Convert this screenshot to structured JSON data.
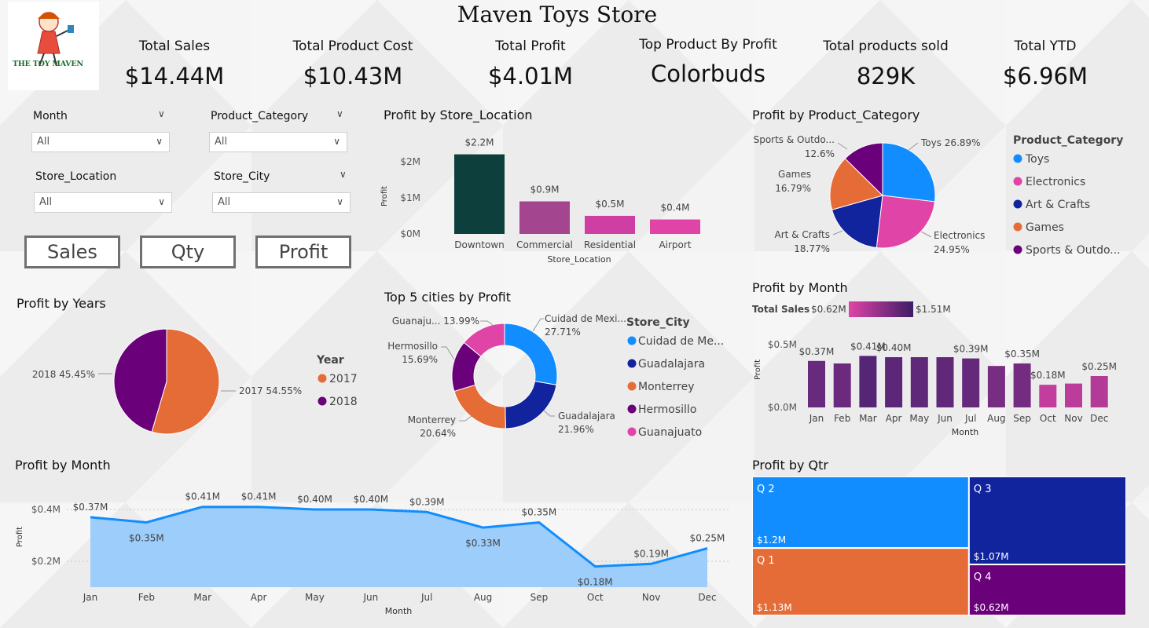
{
  "header": {
    "title": "Maven Toys Store",
    "logo_text": "THE TOY MAVEN"
  },
  "kpis": [
    {
      "label": "Total Sales",
      "value": "$14.44M"
    },
    {
      "label": "Total Product Cost",
      "value": "$10.43M"
    },
    {
      "label": "Total Profit",
      "value": "$4.01M"
    },
    {
      "label": "Top Product By Profit",
      "value": "Colorbuds"
    },
    {
      "label": "Total products sold",
      "value": "829K"
    },
    {
      "label": "Total YTD",
      "value": "$6.96M"
    }
  ],
  "slicers": [
    {
      "label": "Month",
      "value": "All"
    },
    {
      "label": "Product_Category",
      "value": "All"
    },
    {
      "label": "Store_Location",
      "value": "All"
    },
    {
      "label": "Store_City",
      "value": "All"
    }
  ],
  "buttons": {
    "sales": "Sales",
    "qty": "Qty",
    "profit": "Profit"
  },
  "colors": {
    "toys": "#118DFF",
    "electronics": "#E044A7",
    "art": "#12239E",
    "games": "#E66C37",
    "sports": "#6B007B",
    "downtown": "#0D3F3C",
    "area_fill": "#9DCDFB",
    "line": "#118DFF"
  },
  "icons": {
    "dropdown": "chevron-down-icon"
  },
  "chart_data": [
    {
      "id": "location",
      "type": "bar",
      "title": "Profit by Store_Location",
      "xlabel": "Store_Location",
      "ylabel": "Profit",
      "categories": [
        "Downtown",
        "Commercial",
        "Residential",
        "Airport"
      ],
      "values": [
        2.2,
        0.9,
        0.5,
        0.4
      ],
      "value_labels": [
        "$2.2M",
        "$0.9M",
        "$0.5M",
        "$0.4M"
      ],
      "ylim": [
        0,
        2.3
      ],
      "yticks": [
        0,
        1,
        2
      ],
      "ytick_labels": [
        "$0M",
        "$1M",
        "$2M"
      ]
    },
    {
      "id": "category",
      "type": "pie",
      "title": "Profit by Product_Category",
      "legend_title": "Product_Category",
      "legend_labels": [
        "Toys",
        "Electronics",
        "Art & Crafts",
        "Games",
        "Sports & Outdo..."
      ],
      "slice_names": [
        "Toys",
        "Electronics",
        "Art & Crafts",
        "Games",
        "Sports & Outdo..."
      ],
      "values": [
        26.89,
        24.95,
        18.77,
        16.79,
        12.6
      ],
      "value_labels": [
        "26.89%",
        "24.95%",
        "18.77%",
        "16.79%",
        "12.6%"
      ]
    },
    {
      "id": "years",
      "type": "pie",
      "title": "Profit by Years",
      "legend_title": "Year",
      "categories": [
        "2017",
        "2018"
      ],
      "values": [
        54.55,
        45.45
      ],
      "value_labels": [
        "54.55%",
        "45.45%"
      ]
    },
    {
      "id": "cities",
      "type": "pie",
      "donut": true,
      "title": "Top 5 cities by Profit",
      "legend_title": "Store_City",
      "legend_labels": [
        "Cuidad de Me...",
        "Guadalajara",
        "Monterrey",
        "Hermosillo",
        "Guanajuato"
      ],
      "slice_names": [
        "Cuidad de Mexi...",
        "Guadalajara",
        "Monterrey",
        "Hermosillo",
        "Guanaju..."
      ],
      "values": [
        27.71,
        21.96,
        20.64,
        15.69,
        13.99
      ],
      "value_labels": [
        "27.71%",
        "21.96%",
        "20.64%",
        "15.69%",
        "13.99%"
      ]
    },
    {
      "id": "month_bar",
      "type": "bar",
      "title": "Profit by Month",
      "xlabel": "Month",
      "ylabel": "Profit",
      "color_legend": {
        "label": "Total Sales",
        "min_label": "$0.62M",
        "max_label": "$1.51M"
      },
      "categories": [
        "Jan",
        "Feb",
        "Mar",
        "Apr",
        "May",
        "Jun",
        "Jul",
        "Aug",
        "Sep",
        "Oct",
        "Nov",
        "Dec"
      ],
      "values": [
        0.37,
        0.35,
        0.41,
        0.4,
        0.4,
        0.4,
        0.39,
        0.33,
        0.35,
        0.18,
        0.19,
        0.25
      ],
      "value_labels": [
        "$0.37M",
        "",
        "$0.41M",
        "$0.40M",
        "",
        "",
        "$0.39M",
        "",
        "$0.35M",
        "$0.18M",
        "",
        "$0.25M"
      ],
      "sales_shade": [
        0.8,
        0.78,
        0.92,
        0.88,
        0.86,
        0.85,
        0.83,
        0.7,
        0.72,
        0.2,
        0.25,
        0.3
      ],
      "ylim": [
        0,
        0.5
      ],
      "yticks": [
        0,
        0.5
      ],
      "ytick_labels": [
        "$0.0M",
        "$0.5M"
      ]
    },
    {
      "id": "month_area",
      "type": "area",
      "title": "Profit by Month",
      "xlabel": "Month",
      "ylabel": "Profit",
      "categories": [
        "Jan",
        "Feb",
        "Mar",
        "Apr",
        "May",
        "Jun",
        "Jul",
        "Aug",
        "Sep",
        "Oct",
        "Nov",
        "Dec"
      ],
      "values": [
        0.37,
        0.35,
        0.41,
        0.41,
        0.4,
        0.4,
        0.39,
        0.33,
        0.35,
        0.18,
        0.19,
        0.25
      ],
      "value_labels": [
        "$0.37M",
        "$0.35M",
        "$0.41M",
        "$0.41M",
        "$0.40M",
        "$0.40M",
        "$0.39M",
        "$0.33M",
        "$0.35M",
        "$0.18M",
        "$0.19M",
        "$0.25M"
      ],
      "label_below": [
        false,
        true,
        false,
        false,
        false,
        false,
        false,
        true,
        false,
        true,
        false,
        false
      ],
      "ylim": [
        0.1,
        0.5
      ],
      "yticks": [
        0.2,
        0.4
      ],
      "ytick_labels": [
        "$0.2M",
        "$0.4M"
      ]
    },
    {
      "id": "qtr",
      "type": "treemap",
      "title": "Profit by Qtr",
      "categories": [
        "Q 2",
        "Q 1",
        "Q 3",
        "Q 4"
      ],
      "values": [
        1.2,
        1.13,
        1.07,
        0.62
      ],
      "value_labels": [
        "$1.2M",
        "$1.13M",
        "$1.07M",
        "$0.62M"
      ]
    }
  ]
}
